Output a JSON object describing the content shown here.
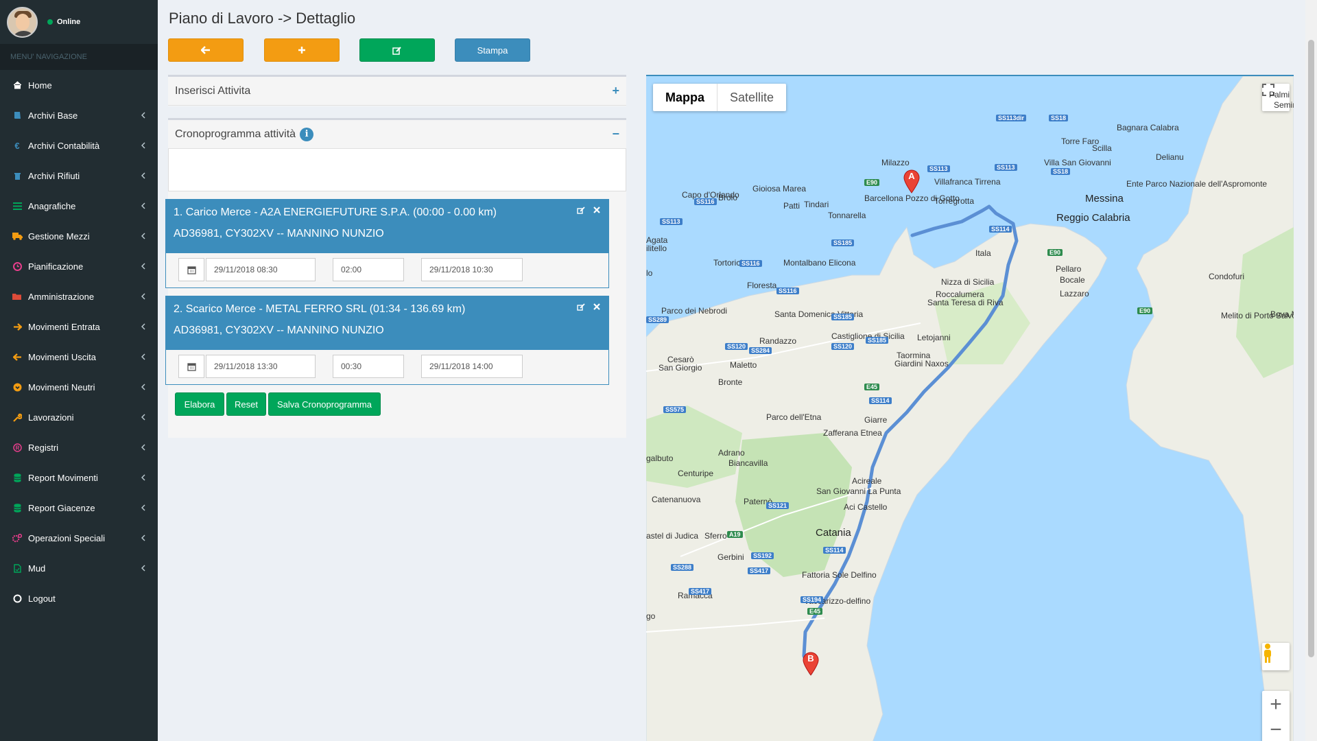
{
  "sidebar": {
    "status": "Online",
    "menu_header": "MENU' NAVIGAZIONE",
    "items": [
      {
        "label": "Home",
        "icon": "home-icon",
        "color": "#ffffff",
        "chevron": false
      },
      {
        "label": "Archivi Base",
        "icon": "book-icon",
        "color": "#3c8dbc",
        "chevron": true
      },
      {
        "label": "Archivi Contabilità",
        "icon": "euro-icon",
        "color": "#3c8dbc",
        "chevron": true
      },
      {
        "label": "Archivi Rifiuti",
        "icon": "trash-icon",
        "color": "#3c8dbc",
        "chevron": true
      },
      {
        "label": "Anagrafiche",
        "icon": "list-icon",
        "color": "#00a65a",
        "chevron": true
      },
      {
        "label": "Gestione Mezzi",
        "icon": "truck-icon",
        "color": "#f39c12",
        "chevron": true
      },
      {
        "label": "Pianificazione",
        "icon": "clock-icon",
        "color": "#e83e8c",
        "chevron": true
      },
      {
        "label": "Amministrazione",
        "icon": "folder-icon",
        "color": "#dd4b39",
        "chevron": true
      },
      {
        "label": "Movimenti Entrata",
        "icon": "arrow-right-icon",
        "color": "#f39c12",
        "chevron": true
      },
      {
        "label": "Movimenti Uscita",
        "icon": "arrow-left-icon",
        "color": "#f39c12",
        "chevron": true
      },
      {
        "label": "Movimenti Neutri",
        "icon": "circle-arrow-icon",
        "color": "#f39c12",
        "chevron": true
      },
      {
        "label": "Lavorazioni",
        "icon": "wrench-icon",
        "color": "#f39c12",
        "chevron": true
      },
      {
        "label": "Registri",
        "icon": "registered-icon",
        "color": "#e83e8c",
        "chevron": true
      },
      {
        "label": "Report Movimenti",
        "icon": "database-icon",
        "color": "#00a65a",
        "chevron": true
      },
      {
        "label": "Report Giacenze",
        "icon": "database-icon",
        "color": "#00a65a",
        "chevron": true
      },
      {
        "label": "Operazioni Speciali",
        "icon": "cogs-icon",
        "color": "#e83e8c",
        "chevron": true
      },
      {
        "label": "Mud",
        "icon": "file-icon",
        "color": "#00a65a",
        "chevron": true
      },
      {
        "label": "Logout",
        "icon": "power-icon",
        "color": "#ffffff",
        "chevron": false
      }
    ]
  },
  "header": {
    "title": "Piano di Lavoro -> Dettaglio"
  },
  "toolbar": {
    "back_icon": "arrow-left-icon",
    "add_icon": "plus-icon",
    "edit_icon": "edit-icon",
    "print_label": "Stampa"
  },
  "insert_box": {
    "title": "Inserisci Attivita",
    "tool": "+"
  },
  "schedule_box": {
    "title": "Cronoprogramma attività",
    "info": "i",
    "tool": "−"
  },
  "tasks": [
    {
      "title": "1. Carico Merce - A2A ENERGIEFUTURE S.P.A. (00:00 - 0.00 km)",
      "subtitle": "AD36981, CY302XV -- MANNINO NUNZIO",
      "start": "29/11/2018 08:30",
      "duration": "02:00",
      "end": "29/11/2018 10:30"
    },
    {
      "title": "2. Scarico Merce - METAL FERRO SRL (01:34 - 136.69 km)",
      "subtitle": "AD36981, CY302XV -- MANNINO NUNZIO",
      "start": "29/11/2018 13:30",
      "duration": "00:30",
      "end": "29/11/2018 14:00"
    }
  ],
  "actions": {
    "elabora": "Elabora",
    "reset": "Reset",
    "salva": "Salva Cronoprogramma"
  },
  "map": {
    "type_map": "Mappa",
    "type_satellite": "Satellite",
    "marker_a": "A",
    "marker_b": "B",
    "zoom_in": "+",
    "zoom_out": "−",
    "places": {
      "milazzo": "Milazzo",
      "messina": "Messina",
      "torregrotta": "Torregrotta",
      "villafranca": "Villafranca Tirrena",
      "barcellona": "Barcellona Pozzo di Gotto",
      "reggio": "Reggio Calabria",
      "catania": "Catania",
      "acireale": "Acireale",
      "giarre": "Giarre",
      "taormina": "Taormina",
      "giardini": "Giardini Naxos",
      "etna": "Parco dell'Etna",
      "nebrodi": "Parco dei Nebrodi",
      "aspromonte": "Ente Parco Nazionale dell'Aspromonte",
      "paterno": "Paternò",
      "bronte": "Bronte",
      "adrano": "Adrano",
      "biancavilla": "Biancavilla",
      "randazzo": "Randazzo",
      "patti": "Patti",
      "tindari": "Tindari",
      "capo": "Capo d'Orlando",
      "brolo": "Brolo",
      "gioiosa": "Gioiosa Marea",
      "tonnarella": "Tonnarella",
      "torre_faro": "Torre Faro",
      "scilla": "Scilla",
      "villa_sg": "Villa San Giovanni",
      "bagnara": "Bagnara Calabra",
      "delianu": "Delianu",
      "itala": "Itala",
      "nizza": "Nizza di Sicilia",
      "roccalumera": "Roccalumera",
      "santa_teresa": "Santa Teresa di Riva",
      "letojanni": "Letojanni",
      "castiglione": "Castiglione di Sicilia",
      "santa_domenica": "Santa Domenica Vittoria",
      "floresta": "Floresta",
      "montalbano": "Montalbano Elicona",
      "tortorici": "Tortorici",
      "cesaro": "Cesarò",
      "sangiorgio": "San Giorgio",
      "maletto": "Maletto",
      "zafferana": "Zafferana Etnea",
      "san_giovanni": "San Giovanni La Punta",
      "aci_castello": "Aci Castello",
      "catenanuova": "Catenanuova",
      "centuripe": "Centuripe",
      "sferro": "Sferro",
      "gerbini": "Gerbini",
      "ramacca": "Ramacca",
      "fattoria": "Fattoria Sole Delfino",
      "vaccarizzo": "Vaccarizzo-delfino",
      "pellaro": "Pellaro",
      "bocale": "Bocale",
      "lazzaro": "Lazzaro",
      "condofuri": "Condofuri",
      "melito": "Melito di Porto Salvo",
      "bova": "Bova M",
      "palmi": "Palmi",
      "seminara": "Seminara",
      "agata": "Agata",
      "militello": "ilitello",
      "galbuto": "galbuto",
      "castel_judica": "astel di Judica",
      "go": "go",
      "lo": "lo"
    },
    "roads": [
      "SS113dir",
      "SS113",
      "SS113",
      "SS18",
      "SS18",
      "SS114",
      "E90",
      "SS116",
      "SS116",
      "SS116",
      "SS113",
      "SS185",
      "SS185",
      "SS185",
      "SS289",
      "SS120",
      "SS284",
      "SS120",
      "E45",
      "SS114",
      "SS575",
      "SS121",
      "SS114",
      "SS192",
      "SS288",
      "SS417",
      "SS417",
      "SS194",
      "E45",
      "E90",
      "E90",
      "A19"
    ]
  }
}
